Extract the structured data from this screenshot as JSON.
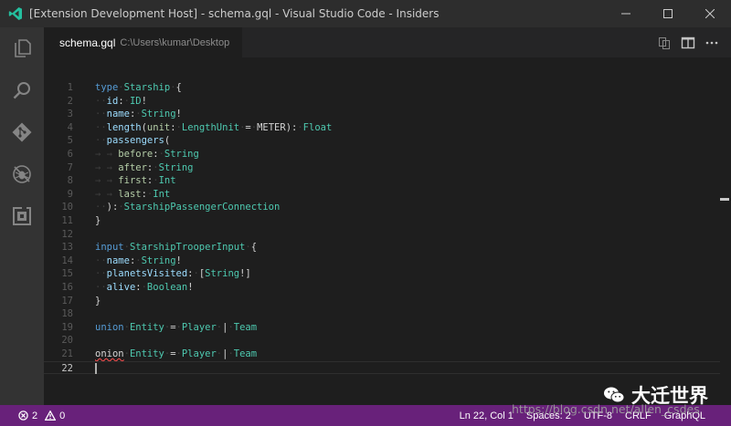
{
  "window": {
    "title": "[Extension Development Host] - schema.gql - Visual Studio Code - Insiders",
    "controls": [
      "minimize",
      "maximize",
      "close"
    ]
  },
  "activity_bar": {
    "items": [
      {
        "name": "explorer",
        "icon": "files-icon"
      },
      {
        "name": "search",
        "icon": "search-icon"
      },
      {
        "name": "source-control",
        "icon": "git-icon"
      },
      {
        "name": "debug",
        "icon": "bug-icon"
      },
      {
        "name": "extensions",
        "icon": "extensions-icon"
      }
    ]
  },
  "editor": {
    "tab": {
      "name": "schema.gql",
      "path": "C:\\Users\\kumar\\Desktop"
    },
    "tab_actions": [
      "open-changes-icon",
      "split-editor-icon",
      "more-icon"
    ],
    "current_line": 22,
    "lines": [
      {
        "n": "1",
        "t": [
          [
            "kw",
            "type"
          ],
          [
            "ws",
            "·"
          ],
          [
            "ty",
            "Starship"
          ],
          [
            "ws",
            "·"
          ],
          [
            "pn",
            "{"
          ]
        ]
      },
      {
        "n": "2",
        "t": [
          [
            "ws",
            "··"
          ],
          [
            "fd",
            "id"
          ],
          [
            "pn",
            ":"
          ],
          [
            "ws",
            "·"
          ],
          [
            "ty",
            "ID"
          ],
          [
            "pn",
            "!"
          ]
        ]
      },
      {
        "n": "3",
        "t": [
          [
            "ws",
            "··"
          ],
          [
            "fd",
            "name"
          ],
          [
            "pn",
            ":"
          ],
          [
            "ws",
            "·"
          ],
          [
            "ty",
            "String"
          ],
          [
            "pn",
            "!"
          ]
        ]
      },
      {
        "n": "4",
        "t": [
          [
            "ws",
            "··"
          ],
          [
            "fd",
            "length"
          ],
          [
            "pn",
            "("
          ],
          [
            "ar",
            "unit"
          ],
          [
            "pn",
            ":"
          ],
          [
            "ws",
            "·"
          ],
          [
            "ty",
            "LengthUnit"
          ],
          [
            "ws",
            "·"
          ],
          [
            "pn",
            "="
          ],
          [
            "ws",
            "·"
          ],
          [
            "pn",
            "METER"
          ],
          [
            "pn",
            "):"
          ],
          [
            "ws",
            "·"
          ],
          [
            "ty",
            "Float"
          ]
        ]
      },
      {
        "n": "5",
        "t": [
          [
            "ws",
            "··"
          ],
          [
            "fd",
            "passengers"
          ],
          [
            "pn",
            "("
          ]
        ]
      },
      {
        "n": "6",
        "t": [
          [
            "ws",
            "→ → "
          ],
          [
            "ar",
            "before"
          ],
          [
            "pn",
            ":"
          ],
          [
            "ws",
            "·"
          ],
          [
            "ty",
            "String"
          ]
        ]
      },
      {
        "n": "7",
        "t": [
          [
            "ws",
            "→ → "
          ],
          [
            "ar",
            "after"
          ],
          [
            "pn",
            ":"
          ],
          [
            "ws",
            "·"
          ],
          [
            "ty",
            "String"
          ]
        ]
      },
      {
        "n": "8",
        "t": [
          [
            "ws",
            "→ → "
          ],
          [
            "ar",
            "first"
          ],
          [
            "pn",
            ":"
          ],
          [
            "ws",
            "·"
          ],
          [
            "ty",
            "Int"
          ]
        ]
      },
      {
        "n": "9",
        "t": [
          [
            "ws",
            "→ → "
          ],
          [
            "ar",
            "last"
          ],
          [
            "pn",
            ":"
          ],
          [
            "ws",
            "·"
          ],
          [
            "ty",
            "Int"
          ]
        ]
      },
      {
        "n": "10",
        "t": [
          [
            "ws",
            "··"
          ],
          [
            "pn",
            "):"
          ],
          [
            "ws",
            "·"
          ],
          [
            "ty",
            "StarshipPassengerConnection"
          ]
        ]
      },
      {
        "n": "11",
        "t": [
          [
            "pn",
            "}"
          ]
        ]
      },
      {
        "n": "12",
        "t": []
      },
      {
        "n": "13",
        "t": [
          [
            "kw",
            "input"
          ],
          [
            "ws",
            "·"
          ],
          [
            "ty",
            "StarshipTrooperInput"
          ],
          [
            "ws",
            "·"
          ],
          [
            "pn",
            "{"
          ]
        ]
      },
      {
        "n": "14",
        "t": [
          [
            "ws",
            "··"
          ],
          [
            "fd",
            "name"
          ],
          [
            "pn",
            ":"
          ],
          [
            "ws",
            "·"
          ],
          [
            "ty",
            "String"
          ],
          [
            "pn",
            "!"
          ]
        ]
      },
      {
        "n": "15",
        "t": [
          [
            "ws",
            "··"
          ],
          [
            "fd",
            "planetsVisited"
          ],
          [
            "pn",
            ":"
          ],
          [
            "ws",
            "·"
          ],
          [
            "pn",
            "["
          ],
          [
            "ty",
            "String"
          ],
          [
            "pn",
            "!]"
          ]
        ]
      },
      {
        "n": "16",
        "t": [
          [
            "ws",
            "··"
          ],
          [
            "fd",
            "alive"
          ],
          [
            "pn",
            ":"
          ],
          [
            "ws",
            "·"
          ],
          [
            "ty",
            "Boolean"
          ],
          [
            "pn",
            "!"
          ]
        ]
      },
      {
        "n": "17",
        "t": [
          [
            "pn",
            "}"
          ]
        ]
      },
      {
        "n": "18",
        "t": []
      },
      {
        "n": "19",
        "t": [
          [
            "kw",
            "union"
          ],
          [
            "ws",
            "·"
          ],
          [
            "ty",
            "Entity"
          ],
          [
            "ws",
            "·"
          ],
          [
            "pn",
            "="
          ],
          [
            "ws",
            "·"
          ],
          [
            "ty",
            "Player"
          ],
          [
            "ws",
            "·"
          ],
          [
            "pn",
            "|"
          ],
          [
            "ws",
            "·"
          ],
          [
            "ty",
            "Team"
          ]
        ]
      },
      {
        "n": "20",
        "t": []
      },
      {
        "n": "21",
        "t": [
          [
            "pn err",
            "onion"
          ],
          [
            "ws",
            "·"
          ],
          [
            "ty",
            "Entity"
          ],
          [
            "ws",
            "·"
          ],
          [
            "pn",
            "="
          ],
          [
            "ws",
            "·"
          ],
          [
            "ty",
            "Player"
          ],
          [
            "ws",
            "·"
          ],
          [
            "pn",
            "|"
          ],
          [
            "ws",
            "·"
          ],
          [
            "ty",
            "Team"
          ]
        ]
      },
      {
        "n": "22",
        "t": []
      }
    ]
  },
  "status_bar": {
    "errors": "2",
    "warnings": "0",
    "position": "Ln 22, Col 1",
    "spaces": "Spaces: 2",
    "encoding": "UTF-8",
    "eol": "CRLF",
    "language": "GraphQL",
    "background_color": "#68217a"
  },
  "watermark": {
    "channel": "大迁世界",
    "url": "https://blog.csdn.net/allen_csdes"
  }
}
